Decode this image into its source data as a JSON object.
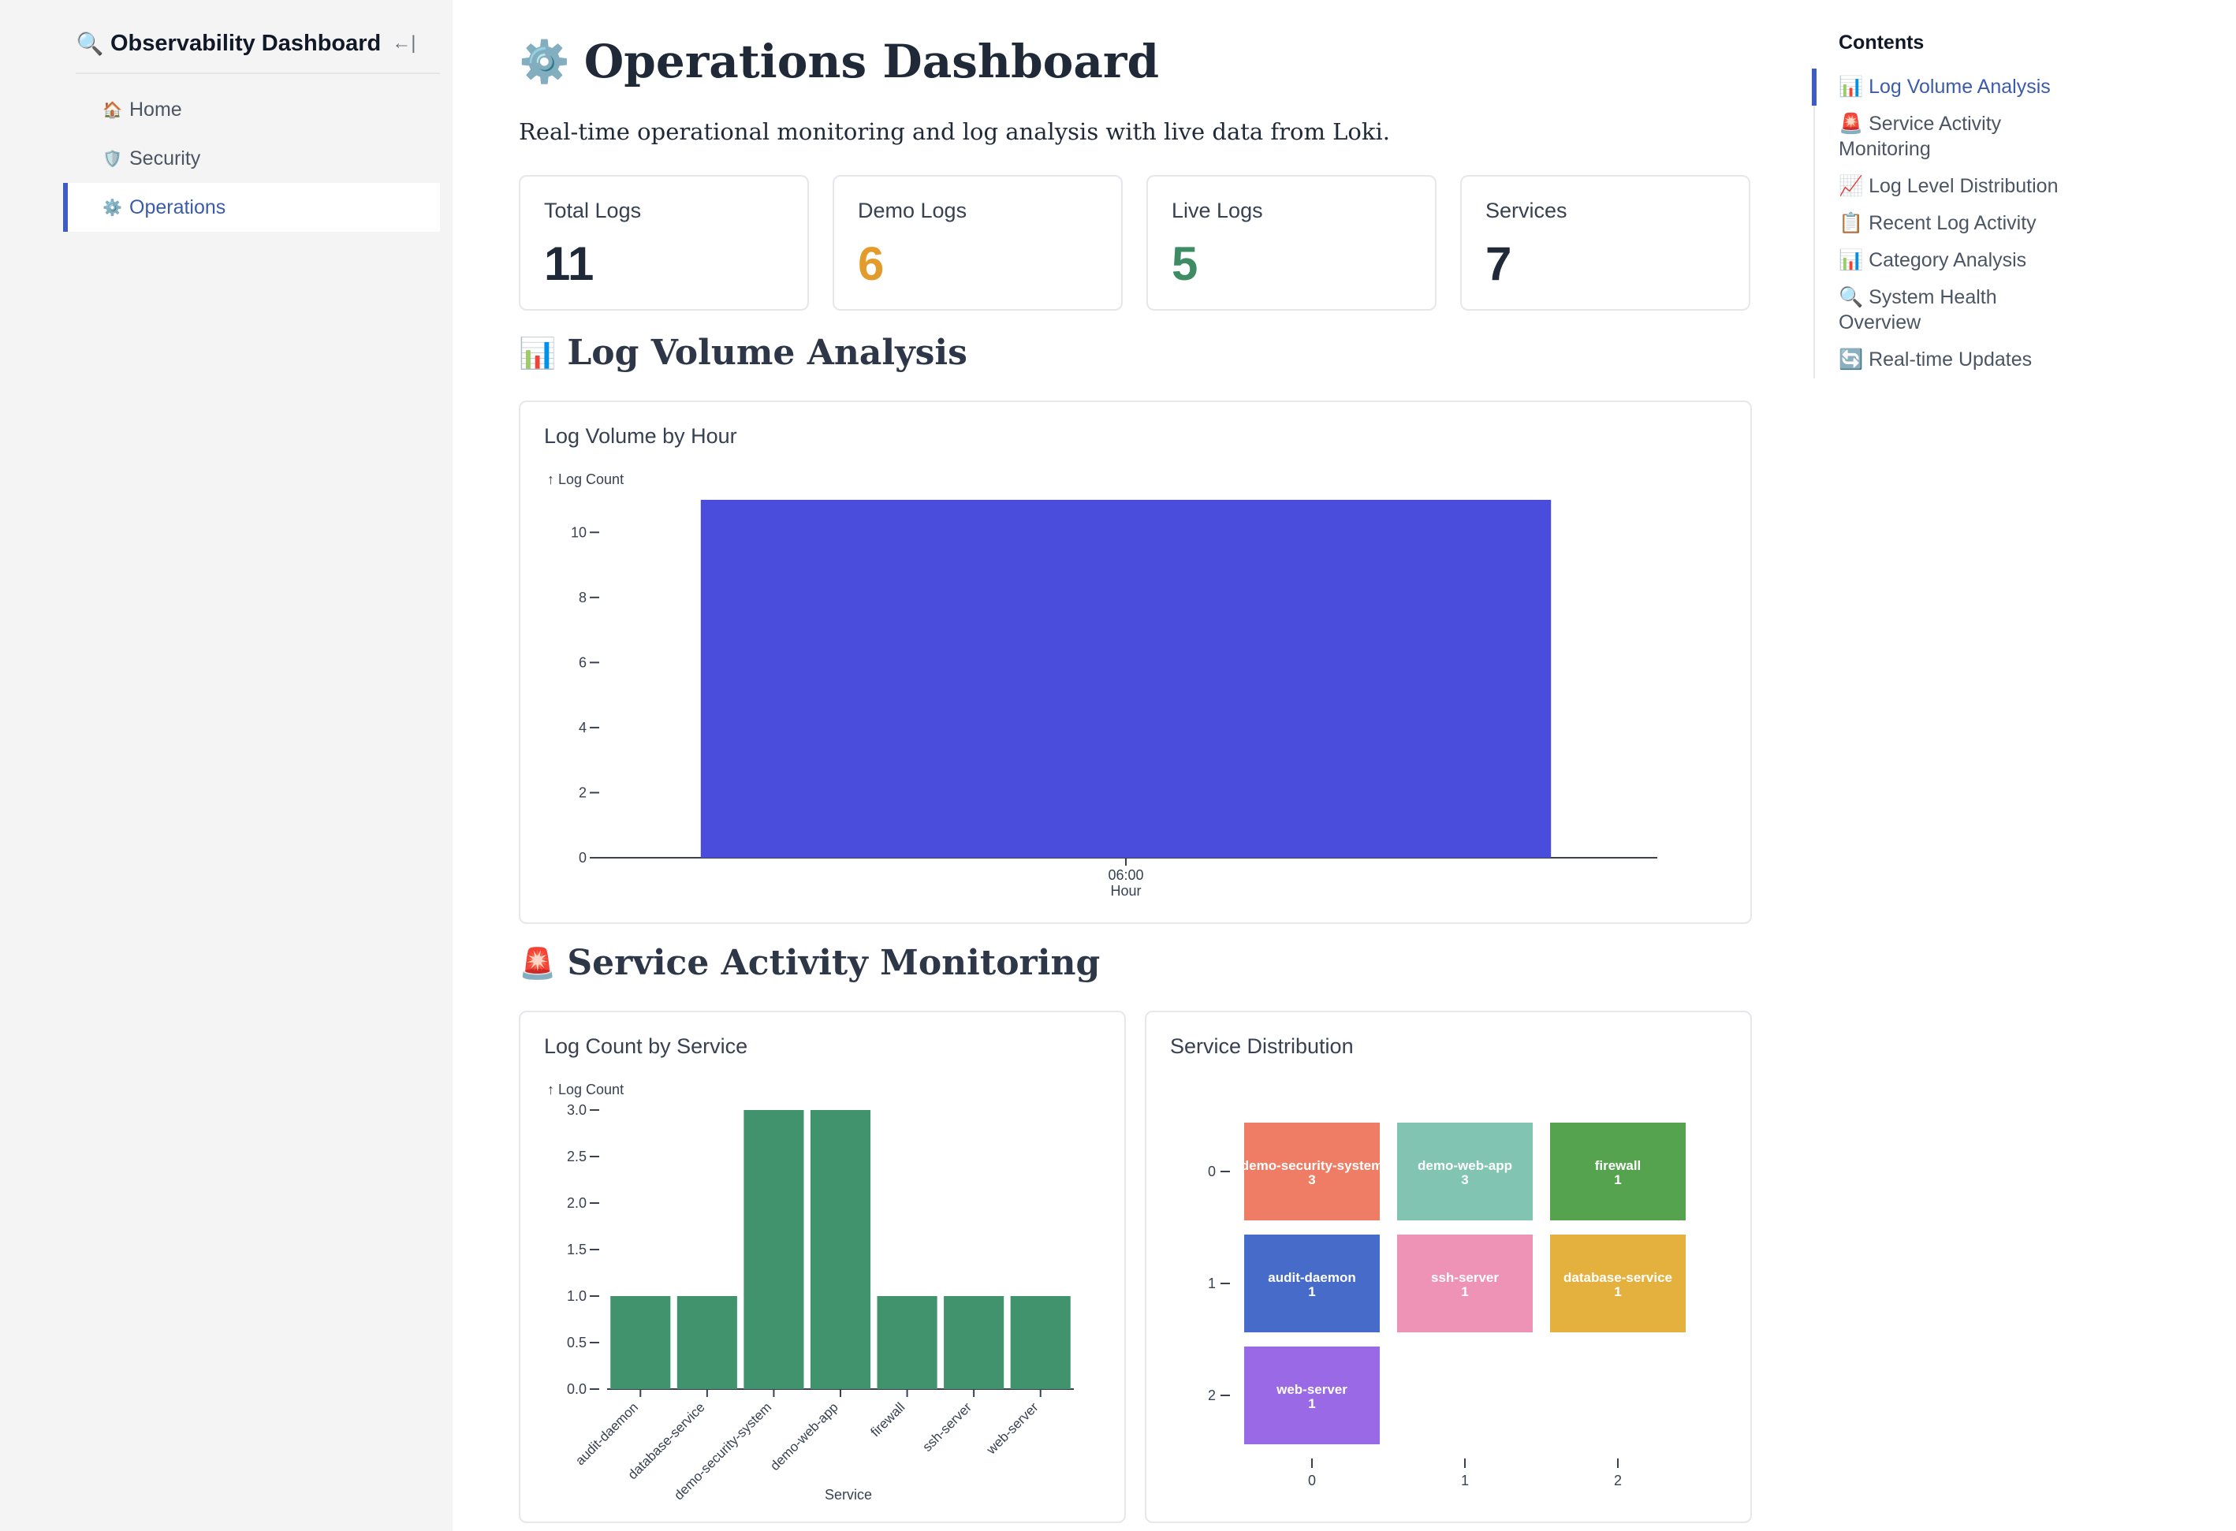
{
  "sidebar": {
    "title": "Observability Dashboard",
    "title_icon": "🔍",
    "collapse_icon": "←|",
    "items": [
      {
        "icon": "🏠",
        "label": "Home"
      },
      {
        "icon": "🛡️",
        "label": "Security"
      },
      {
        "icon": "⚙️",
        "label": "Operations",
        "active": true
      }
    ]
  },
  "page": {
    "title_icon": "⚙️",
    "title": "Operations Dashboard",
    "subtitle": "Real-time operational monitoring and log analysis with live data from Loki."
  },
  "stats": [
    {
      "label": "Total Logs",
      "value": "11",
      "color": "#1f2937"
    },
    {
      "label": "Demo Logs",
      "value": "6",
      "color": "#e39b2c"
    },
    {
      "label": "Live Logs",
      "value": "5",
      "color": "#3d8c63"
    },
    {
      "label": "Services",
      "value": "7",
      "color": "#1f2937"
    }
  ],
  "sections": {
    "log_volume": {
      "icon": "📊",
      "title": "Log Volume Analysis"
    },
    "service_activity": {
      "icon": "🚨",
      "title": "Service Activity Monitoring"
    }
  },
  "cards": {
    "log_volume_by_hour": "Log Volume by Hour",
    "log_count_by_service": "Log Count by Service",
    "service_distribution": "Service Distribution"
  },
  "chart_data": [
    {
      "type": "bar",
      "title": "Log Volume by Hour",
      "categories": [
        "06:00"
      ],
      "values": [
        11
      ],
      "xlabel": "Hour",
      "ylabel": "↑ Log Count",
      "ylim": [
        0,
        11
      ],
      "yticks": [
        0,
        2,
        4,
        6,
        8,
        10
      ],
      "color": "#4a4ddc",
      "grid": false
    },
    {
      "type": "bar",
      "title": "Log Count by Service",
      "categories": [
        "audit-daemon",
        "database-service",
        "demo-security-system",
        "demo-web-app",
        "firewall",
        "ssh-server",
        "web-server"
      ],
      "values": [
        1,
        1,
        3,
        3,
        1,
        1,
        1
      ],
      "xlabel": "Service",
      "ylabel": "↑ Log Count",
      "ylim": [
        0,
        3
      ],
      "yticks": [
        "0.0",
        "0.5",
        "1.0",
        "1.5",
        "2.0",
        "2.5",
        "3.0"
      ],
      "color": "#41936d",
      "grid": false
    },
    {
      "type": "heatmap",
      "title": "Service Distribution",
      "xticks": [
        "0",
        "1",
        "2"
      ],
      "yticks": [
        "0",
        "1",
        "2"
      ],
      "cells": [
        {
          "row": 0,
          "col": 0,
          "label": "demo-security-system",
          "value": "3",
          "color": "#ef7d65"
        },
        {
          "row": 0,
          "col": 1,
          "label": "demo-web-app",
          "value": "3",
          "color": "#80c4b1"
        },
        {
          "row": 0,
          "col": 2,
          "label": "firewall",
          "value": "1",
          "color": "#55a34f"
        },
        {
          "row": 1,
          "col": 0,
          "label": "audit-daemon",
          "value": "1",
          "color": "#466bc8"
        },
        {
          "row": 1,
          "col": 1,
          "label": "ssh-server",
          "value": "1",
          "color": "#ee93b5"
        },
        {
          "row": 1,
          "col": 2,
          "label": "database-service",
          "value": "1",
          "color": "#e4b13f"
        },
        {
          "row": 2,
          "col": 0,
          "label": "web-server",
          "value": "1",
          "color": "#9a6ae6"
        }
      ]
    }
  ],
  "toc": {
    "title": "Contents",
    "items": [
      {
        "label": "📊 Log Volume Analysis",
        "active": true
      },
      {
        "label": "🚨 Service Activity Monitoring"
      },
      {
        "label": "📈 Log Level Distribution"
      },
      {
        "label": "📋 Recent Log Activity"
      },
      {
        "label": "📊 Category Analysis"
      },
      {
        "label": "🔍 System Health Overview"
      },
      {
        "label": "🔄 Real-time Updates"
      }
    ]
  }
}
